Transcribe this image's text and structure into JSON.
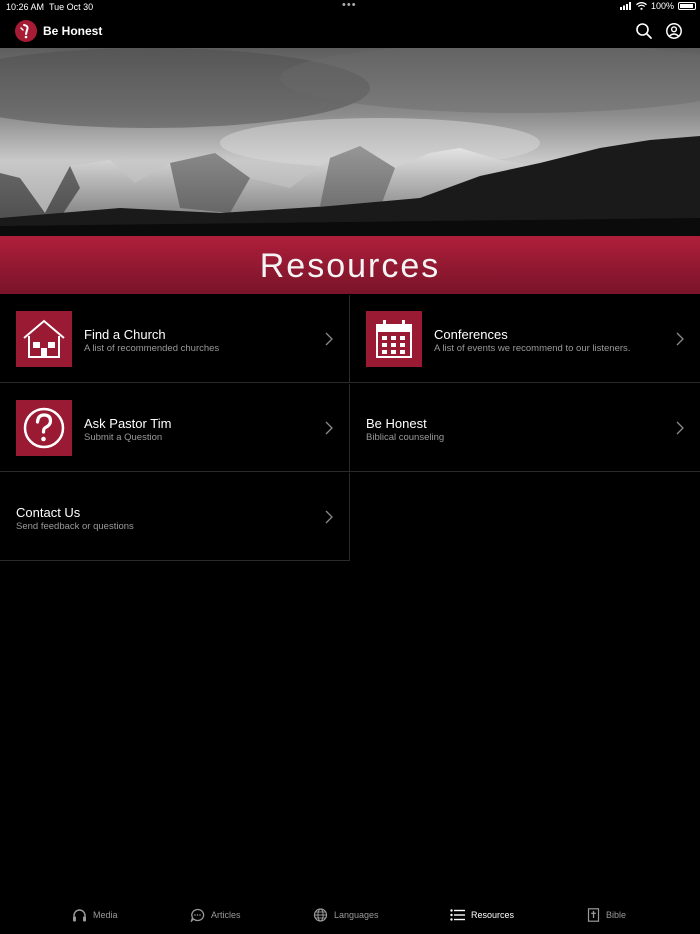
{
  "status": {
    "time": "10:26 AM",
    "date": "Tue Oct 30",
    "dots": "•••",
    "battery": "100%"
  },
  "header": {
    "title": "Be Honest"
  },
  "banner": {
    "title": "Resources"
  },
  "items": [
    {
      "title": "Find a Church",
      "subtitle": "A list of recommended churches"
    },
    {
      "title": "Conferences",
      "subtitle": "A list of events we recommend to our listeners."
    },
    {
      "title": "Ask Pastor Tim",
      "subtitle": "Submit a Question"
    },
    {
      "title": "Be Honest",
      "subtitle": "Biblical counseling"
    },
    {
      "title": "Contact Us",
      "subtitle": "Send feedback or questions"
    }
  ],
  "tabs": [
    {
      "label": "Media",
      "icon": "headphones-icon"
    },
    {
      "label": "Articles",
      "icon": "chat-bubble-icon"
    },
    {
      "label": "Languages",
      "icon": "globe-icon"
    },
    {
      "label": "Resources",
      "icon": "list-icon"
    },
    {
      "label": "Bible",
      "icon": "bible-icon"
    }
  ],
  "colors": {
    "accent": "#9b1a33",
    "background": "#000000",
    "active_tab": "#ffffff",
    "inactive_tab": "#9a9a9a"
  }
}
